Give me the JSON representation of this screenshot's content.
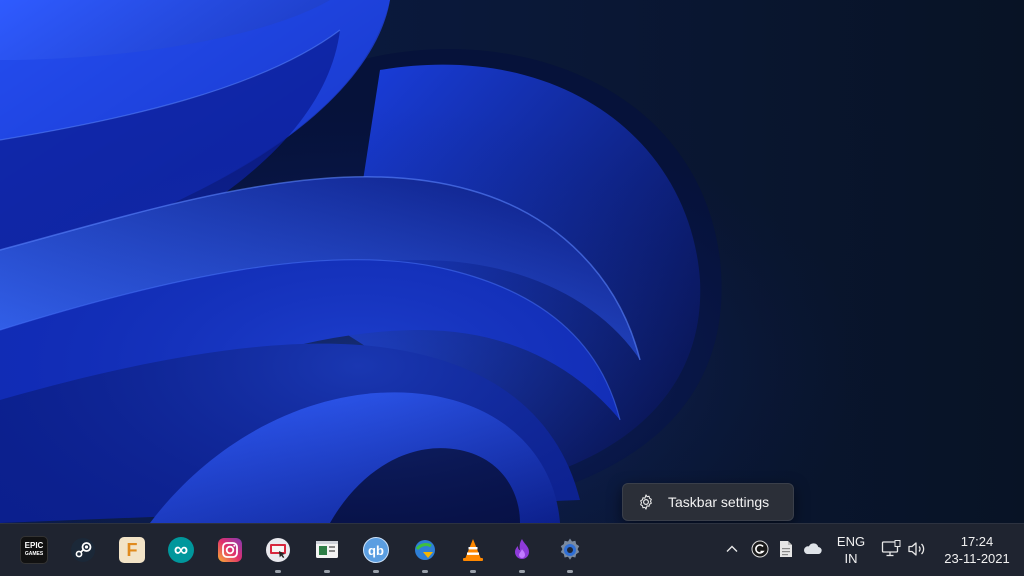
{
  "colors": {
    "wallpaper_dark": "#071226",
    "wallpaper_blue": "#1a3fd6",
    "taskbar_bg": "#1f2430",
    "menu_bg": "#2b2f38"
  },
  "context_menu": {
    "icon": "gear-icon",
    "label": "Taskbar settings"
  },
  "taskbar": {
    "apps": [
      {
        "name": "Epic Games",
        "icon": "epic-games-icon",
        "text": "EPIC",
        "subtext": "GAMES",
        "running": false
      },
      {
        "name": "Steam",
        "icon": "steam-icon",
        "running": false
      },
      {
        "name": "Fusion",
        "icon": "fusion-icon",
        "text": "F",
        "running": false
      },
      {
        "name": "Arduino",
        "icon": "arduino-icon",
        "text": "∞",
        "running": false
      },
      {
        "name": "Instagram",
        "icon": "instagram-icon",
        "running": false
      },
      {
        "name": "Screen capture",
        "icon": "screen-capture-icon",
        "running": true
      },
      {
        "name": "Presentation",
        "icon": "presentation-icon",
        "running": true
      },
      {
        "name": "qBittorrent",
        "icon": "qbittorrent-icon",
        "text": "qb",
        "running": true
      },
      {
        "name": "Internet Download Manager",
        "icon": "idm-icon",
        "running": true
      },
      {
        "name": "VLC",
        "icon": "vlc-icon",
        "running": true
      },
      {
        "name": "Alchemy",
        "icon": "purple-flame-icon",
        "running": true
      },
      {
        "name": "Settings",
        "icon": "settings-gear-icon",
        "running": true
      }
    ],
    "tray": {
      "language_line1": "ENG",
      "language_line2": "IN",
      "time": "17:24",
      "date": "23-11-2021"
    }
  }
}
